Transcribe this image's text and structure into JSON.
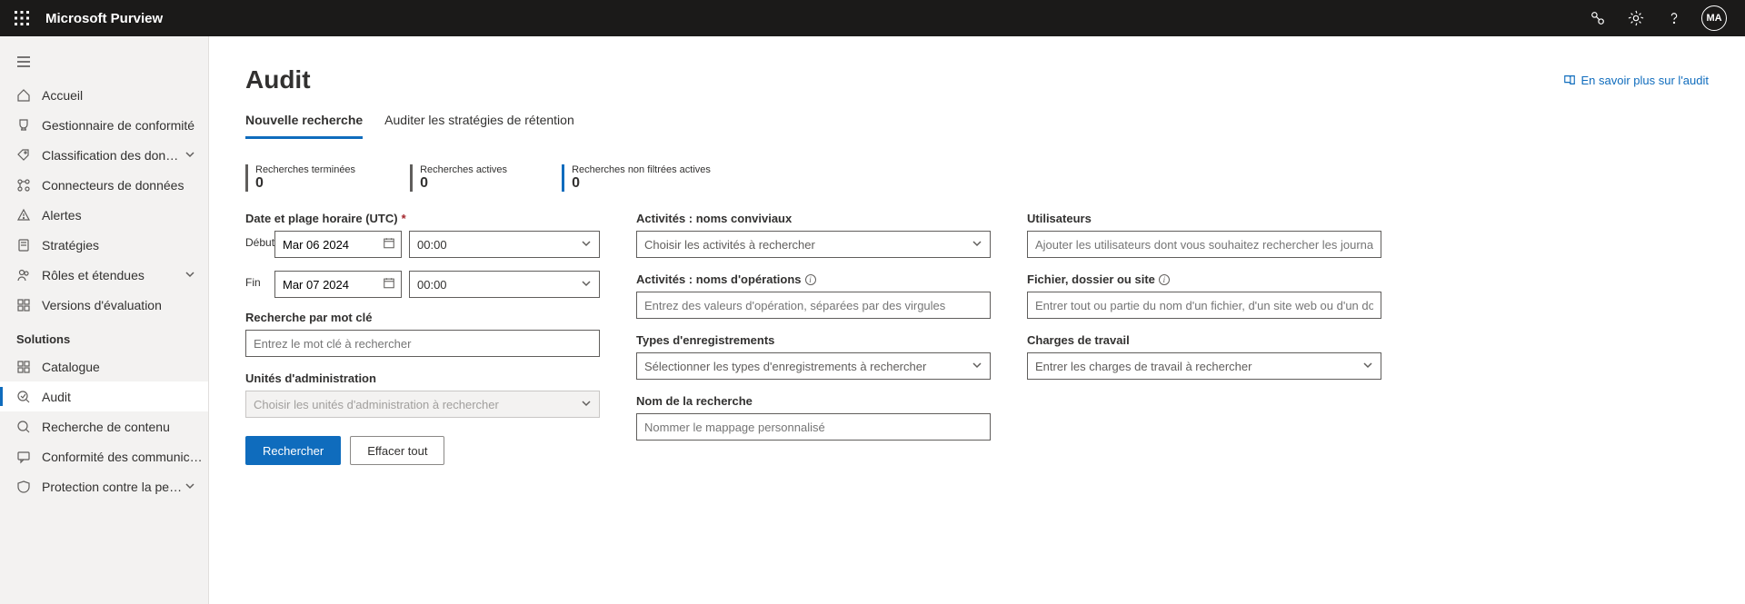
{
  "header": {
    "app_title": "Microsoft Purview",
    "avatar_initials": "MA"
  },
  "sidebar": {
    "items_top": [
      {
        "label": "Accueil",
        "icon": "home",
        "chev": false
      },
      {
        "label": "Gestionnaire de conformité",
        "icon": "trophy",
        "chev": false
      },
      {
        "label": "Classification des données",
        "icon": "tag",
        "chev": true
      },
      {
        "label": "Connecteurs de données",
        "icon": "connector",
        "chev": false
      },
      {
        "label": "Alertes",
        "icon": "alert",
        "chev": false
      },
      {
        "label": "Stratégies",
        "icon": "scroll",
        "chev": false
      },
      {
        "label": "Rôles et étendues",
        "icon": "people",
        "chev": true
      },
      {
        "label": "Versions d'évaluation",
        "icon": "grid",
        "chev": false
      }
    ],
    "section_label": "Solutions",
    "items_solutions": [
      {
        "label": "Catalogue",
        "icon": "catalog",
        "chev": false,
        "active": false
      },
      {
        "label": "Audit",
        "icon": "audit",
        "chev": false,
        "active": true
      },
      {
        "label": "Recherche de contenu",
        "icon": "search",
        "chev": false,
        "active": false
      },
      {
        "label": "Conformité des communications",
        "icon": "comm",
        "chev": false,
        "active": false
      },
      {
        "label": "Protection contre la perte d...",
        "icon": "dlp",
        "chev": true,
        "active": false
      }
    ]
  },
  "page": {
    "title": "Audit",
    "learn_more": "En savoir plus sur l'audit",
    "tabs": [
      {
        "label": "Nouvelle recherche",
        "active": true
      },
      {
        "label": "Auditer les stratégies de rétention",
        "active": false
      }
    ],
    "stats": [
      {
        "label": "Recherches terminées",
        "value": "0",
        "color": "gray"
      },
      {
        "label": "Recherches actives",
        "value": "0",
        "color": "gray"
      },
      {
        "label": "Recherches non filtrées actives",
        "value": "0",
        "color": "blue"
      }
    ]
  },
  "form": {
    "col1": {
      "date_label": "Date et plage horaire (UTC)",
      "start_label": "Début",
      "start_date": "Mar 06 2024",
      "start_time": "00:00",
      "end_label": "Fin",
      "end_date": "Mar 07 2024",
      "end_time": "00:00",
      "keyword_label": "Recherche par mot clé",
      "keyword_placeholder": "Entrez le mot clé à rechercher",
      "admin_label": "Unités d'administration",
      "admin_placeholder": "Choisir les unités d'administration à rechercher",
      "btn_search": "Rechercher",
      "btn_clear": "Effacer tout"
    },
    "col2": {
      "activities_friendly_label": "Activités : noms conviviaux",
      "activities_friendly_placeholder": "Choisir les activités à rechercher",
      "activities_ops_label": "Activités : noms d'opérations",
      "activities_ops_placeholder": "Entrez des valeurs d'opération, séparées par des virgules",
      "record_types_label": "Types d'enregistrements",
      "record_types_placeholder": "Sélectionner les types d'enregistrements à rechercher",
      "search_name_label": "Nom de la recherche",
      "search_name_placeholder": "Nommer le mappage personnalisé"
    },
    "col3": {
      "users_label": "Utilisateurs",
      "users_placeholder": "Ajouter les utilisateurs dont vous souhaitez rechercher les journaux d'audit",
      "file_label": "Fichier, dossier ou site",
      "file_placeholder": "Entrer tout ou partie du nom d'un fichier, d'un site web ou d'un dossier",
      "workloads_label": "Charges de travail",
      "workloads_placeholder": "Entrer les charges de travail à rechercher"
    }
  }
}
